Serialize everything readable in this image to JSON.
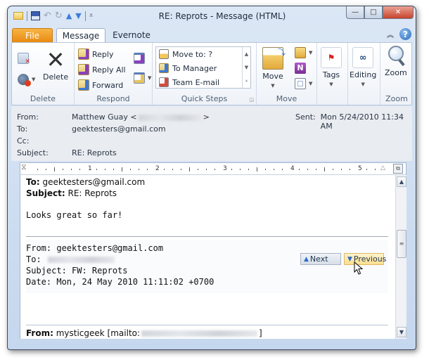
{
  "window": {
    "title": "RE: Reprots  -  Message (HTML)",
    "controls": {
      "minimize": "—",
      "maximize": "□",
      "close": "✕"
    }
  },
  "quick_access": {
    "icons": [
      "mail-icon",
      "save-icon",
      "undo-icon",
      "redo-icon",
      "previous-item-icon",
      "next-item-icon",
      "customize-icon"
    ]
  },
  "tabs": [
    {
      "label": "File",
      "active": false
    },
    {
      "label": "Message",
      "active": true
    },
    {
      "label": "Evernote",
      "active": false
    }
  ],
  "ribbon": {
    "groups": {
      "delete": {
        "label": "Delete",
        "delete_button": "Delete"
      },
      "respond": {
        "label": "Respond",
        "reply": "Reply",
        "reply_all": "Reply All",
        "forward": "Forward"
      },
      "quick_steps": {
        "label": "Quick Steps",
        "items": [
          "Move to: ?",
          "To Manager",
          "Team E-mail"
        ]
      },
      "move": {
        "label": "Move",
        "move_button": "Move"
      },
      "tags": {
        "label": "Tags"
      },
      "editing": {
        "label": "Editing"
      },
      "zoom": {
        "label": "Zoom",
        "zoom_button": "Zoom"
      }
    }
  },
  "message_header": {
    "from_label": "From:",
    "from_value": "Matthew Guay <",
    "from_value_end": ">",
    "to_label": "To:",
    "to_value": "geektesters@gmail.com",
    "cc_label": "Cc:",
    "cc_value": "",
    "subject_label": "Subject:",
    "subject_value": "RE: Reprots",
    "sent_label": "Sent:",
    "sent_value": "Mon 5/24/2010 11:34 AM"
  },
  "ruler": {
    "numbers": [
      "1",
      "2",
      "3",
      "4",
      "5"
    ]
  },
  "body": {
    "to_label": "To:",
    "to_value": " geektesters@gmail.com",
    "subject_label": "Subject:",
    "subject_value": " RE: Reprots",
    "message": "Looks great so far!",
    "quoted": {
      "from": "From: geektesters@gmail.com",
      "to_label": "To: ",
      "subject": "Subject: FW: Reprots",
      "date": "Date: Mon, 24 May 2010 11:11:02 +0700"
    },
    "next_button": "Next",
    "previous_button": "Previous",
    "footer_from_label": "From:",
    "footer_from_value": " mysticgeek [mailto:",
    "footer_from_end": "]"
  }
}
